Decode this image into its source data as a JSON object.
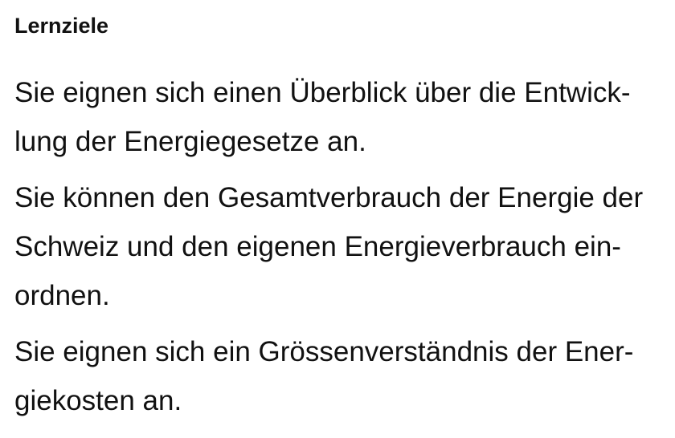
{
  "heading": "Lernziele",
  "goals": [
    {
      "lines": [
        "Sie eignen sich einen Überblick über die Entwick-",
        "lung der Energiegesetze an."
      ]
    },
    {
      "lines": [
        "Sie können den Gesamtverbrauch der Energie der",
        "Schweiz und den eigenen Energieverbrauch ein-",
        "ordnen."
      ]
    },
    {
      "lines": [
        "Sie eignen sich ein Grössenverständnis der Ener-",
        "giekosten an."
      ]
    }
  ]
}
